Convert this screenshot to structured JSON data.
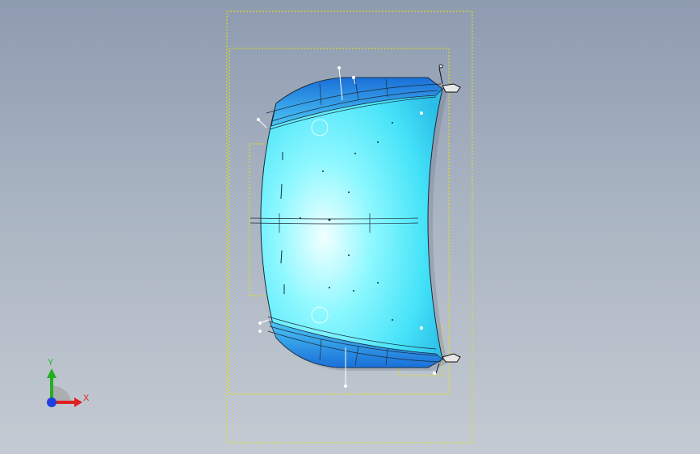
{
  "triad": {
    "x_label": "X",
    "y_label": "Y",
    "x_color": "#e02020",
    "y_color": "#20b020",
    "z_color": "#1f3fe0"
  },
  "colors": {
    "background_top": "#8e9bb0",
    "background_bottom": "#c4cad2",
    "bounding_box": "#e6e600",
    "surface_light": "#80ffff",
    "surface_dark": "#1a73d9"
  }
}
